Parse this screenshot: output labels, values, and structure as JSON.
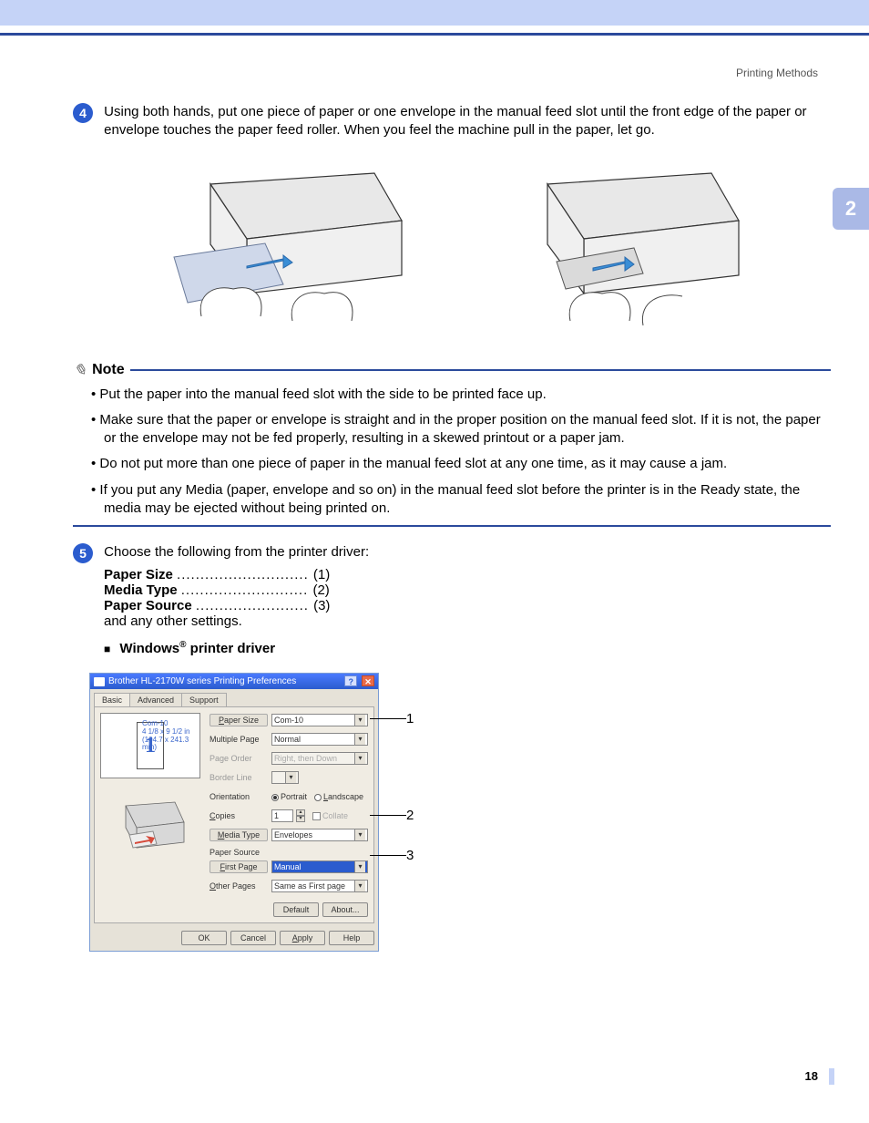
{
  "header": {
    "section_title": "Printing Methods",
    "chapter_tab": "2",
    "page_number": "18"
  },
  "step4": {
    "num": "4",
    "text": "Using both hands, put one piece of paper or one envelope in the manual feed slot until the front edge of the paper or envelope touches the paper feed roller. When you feel the machine pull in the paper, let go."
  },
  "note": {
    "label": "Note",
    "items": [
      "Put the paper into the manual feed slot with the side to be printed face up.",
      "Make sure that the paper or envelope is straight and in the proper position on the manual feed slot. If it is not, the paper or the envelope may not be fed properly, resulting in a skewed printout or a paper jam.",
      "Do not put more than one piece of paper in the manual feed slot at any one time, as it may cause a jam.",
      "If you put any Media (paper, envelope and so on) in the manual feed slot before the printer is in the Ready state, the media may be ejected without being printed on."
    ]
  },
  "step5": {
    "num": "5",
    "intro": "Choose the following from the printer driver:",
    "settings": [
      {
        "label": "Paper Size",
        "num": "(1)"
      },
      {
        "label": "Media Type",
        "num": "(2)"
      },
      {
        "label": "Paper Source",
        "num": "(3)"
      }
    ],
    "outro": "and any other settings.",
    "subhead_prefix": "Windows",
    "subhead_suffix": " printer driver"
  },
  "dialog": {
    "title": "Brother HL-2170W series Printing Preferences",
    "tabs": [
      "Basic",
      "Advanced",
      "Support"
    ],
    "preview": {
      "name": "Com-10",
      "dim1": "4 1/8 x 9 1/2 in",
      "dim2": "(104.7 x 241.3 mm)",
      "page_digit": "1"
    },
    "labels": {
      "paper_size": "Paper Size",
      "multiple_page": "Multiple Page",
      "page_order": "Page Order",
      "border_line": "Border Line",
      "orientation": "Orientation",
      "copies": "Copies",
      "media_type": "Media Type",
      "paper_source": "Paper Source",
      "first_page": "First Page",
      "other_pages": "Other Pages"
    },
    "values": {
      "paper_size": "Com-10",
      "multiple_page": "Normal",
      "page_order": "Right, then Down",
      "orientation_portrait": "Portrait",
      "orientation_landscape": "Landscape",
      "copies": "1",
      "collate": "Collate",
      "media_type": "Envelopes",
      "first_page": "Manual",
      "other_pages": "Same as First page"
    },
    "buttons": {
      "default": "Default",
      "about": "About...",
      "ok": "OK",
      "cancel": "Cancel",
      "apply": "Apply",
      "help": "Help"
    }
  },
  "callouts": {
    "c1": "1",
    "c2": "2",
    "c3": "3"
  }
}
